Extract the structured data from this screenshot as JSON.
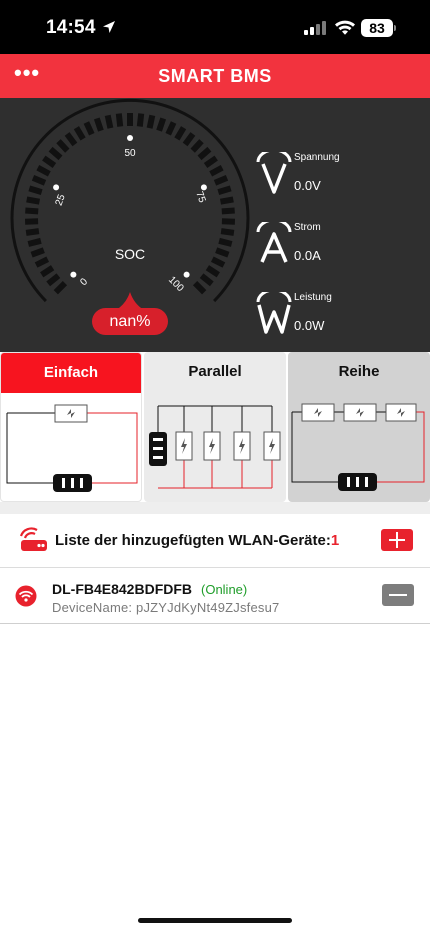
{
  "status_bar": {
    "time": "14:54",
    "battery": "83"
  },
  "header": {
    "title": "SMART BMS",
    "menu_label": "•••"
  },
  "gauge": {
    "label": "SOC",
    "value_text": "nan%",
    "ticks": [
      "0",
      "25",
      "50",
      "75",
      "100"
    ]
  },
  "metrics": [
    {
      "letter": "V",
      "label": "Spannung",
      "value": "0.0V"
    },
    {
      "letter": "A",
      "label": "Strom",
      "value": "0.0A"
    },
    {
      "letter": "W",
      "label": "Leistung",
      "value": "0.0W"
    }
  ],
  "modes": {
    "selected": "Einfach",
    "tabs": [
      {
        "label": "Einfach"
      },
      {
        "label": "Parallel"
      },
      {
        "label": "Reihe"
      }
    ]
  },
  "device_list": {
    "title": "Liste der hinzugefügten WLAN-Geräte:",
    "count": "1",
    "devices": [
      {
        "id": "DL-FB4E842BDFDFB",
        "status": "(Online)",
        "name": "DeviceName: pJZYJdKyNt49ZJsfesu7"
      }
    ]
  },
  "colors": {
    "accent": "#f2333e",
    "dashboard_bg": "#2f2f2f",
    "online": "#1f9d2a"
  }
}
